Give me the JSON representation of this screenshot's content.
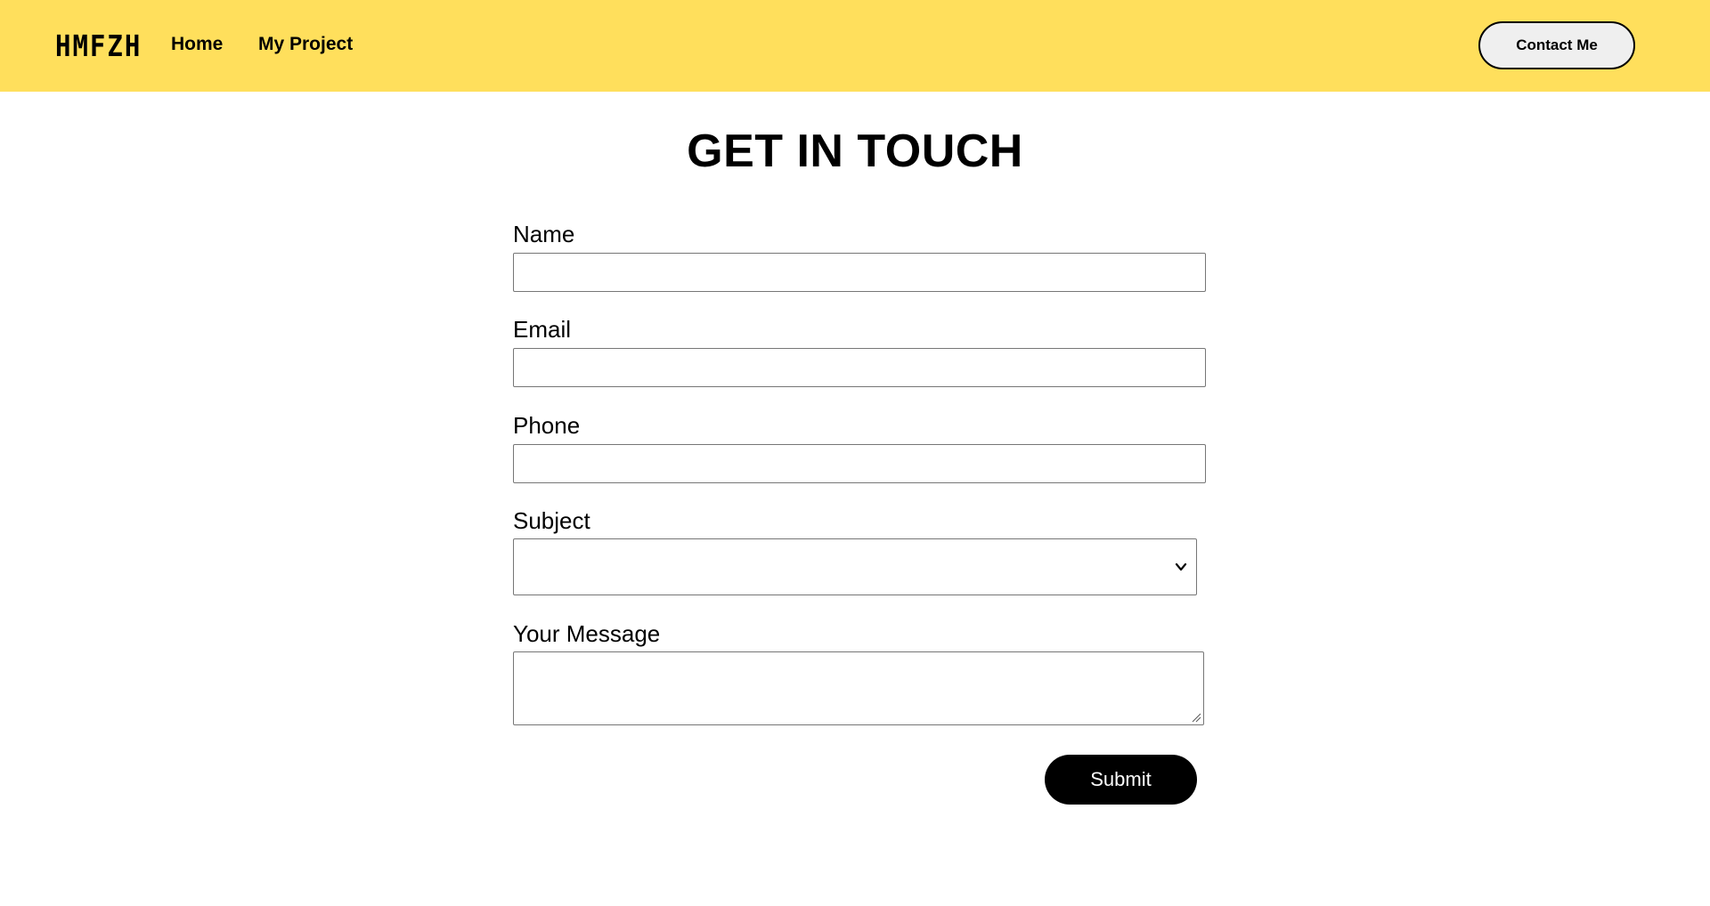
{
  "header": {
    "logo": "HMFZH",
    "nav": [
      {
        "label": "Home"
      },
      {
        "label": "My Project"
      }
    ],
    "contact_button": "Contact Me",
    "background_color": "#ffdf5c"
  },
  "main": {
    "title": "GET IN TOUCH",
    "form": {
      "name": {
        "label": "Name",
        "value": ""
      },
      "email": {
        "label": "Email",
        "value": ""
      },
      "phone": {
        "label": "Phone",
        "value": ""
      },
      "subject": {
        "label": "Subject",
        "selected": ""
      },
      "message": {
        "label": "Your Message",
        "value": ""
      },
      "submit_label": "Submit"
    }
  },
  "icons": {
    "select_arrow": "chevron-down-icon",
    "textarea_resize": "resize-handle-icon"
  }
}
